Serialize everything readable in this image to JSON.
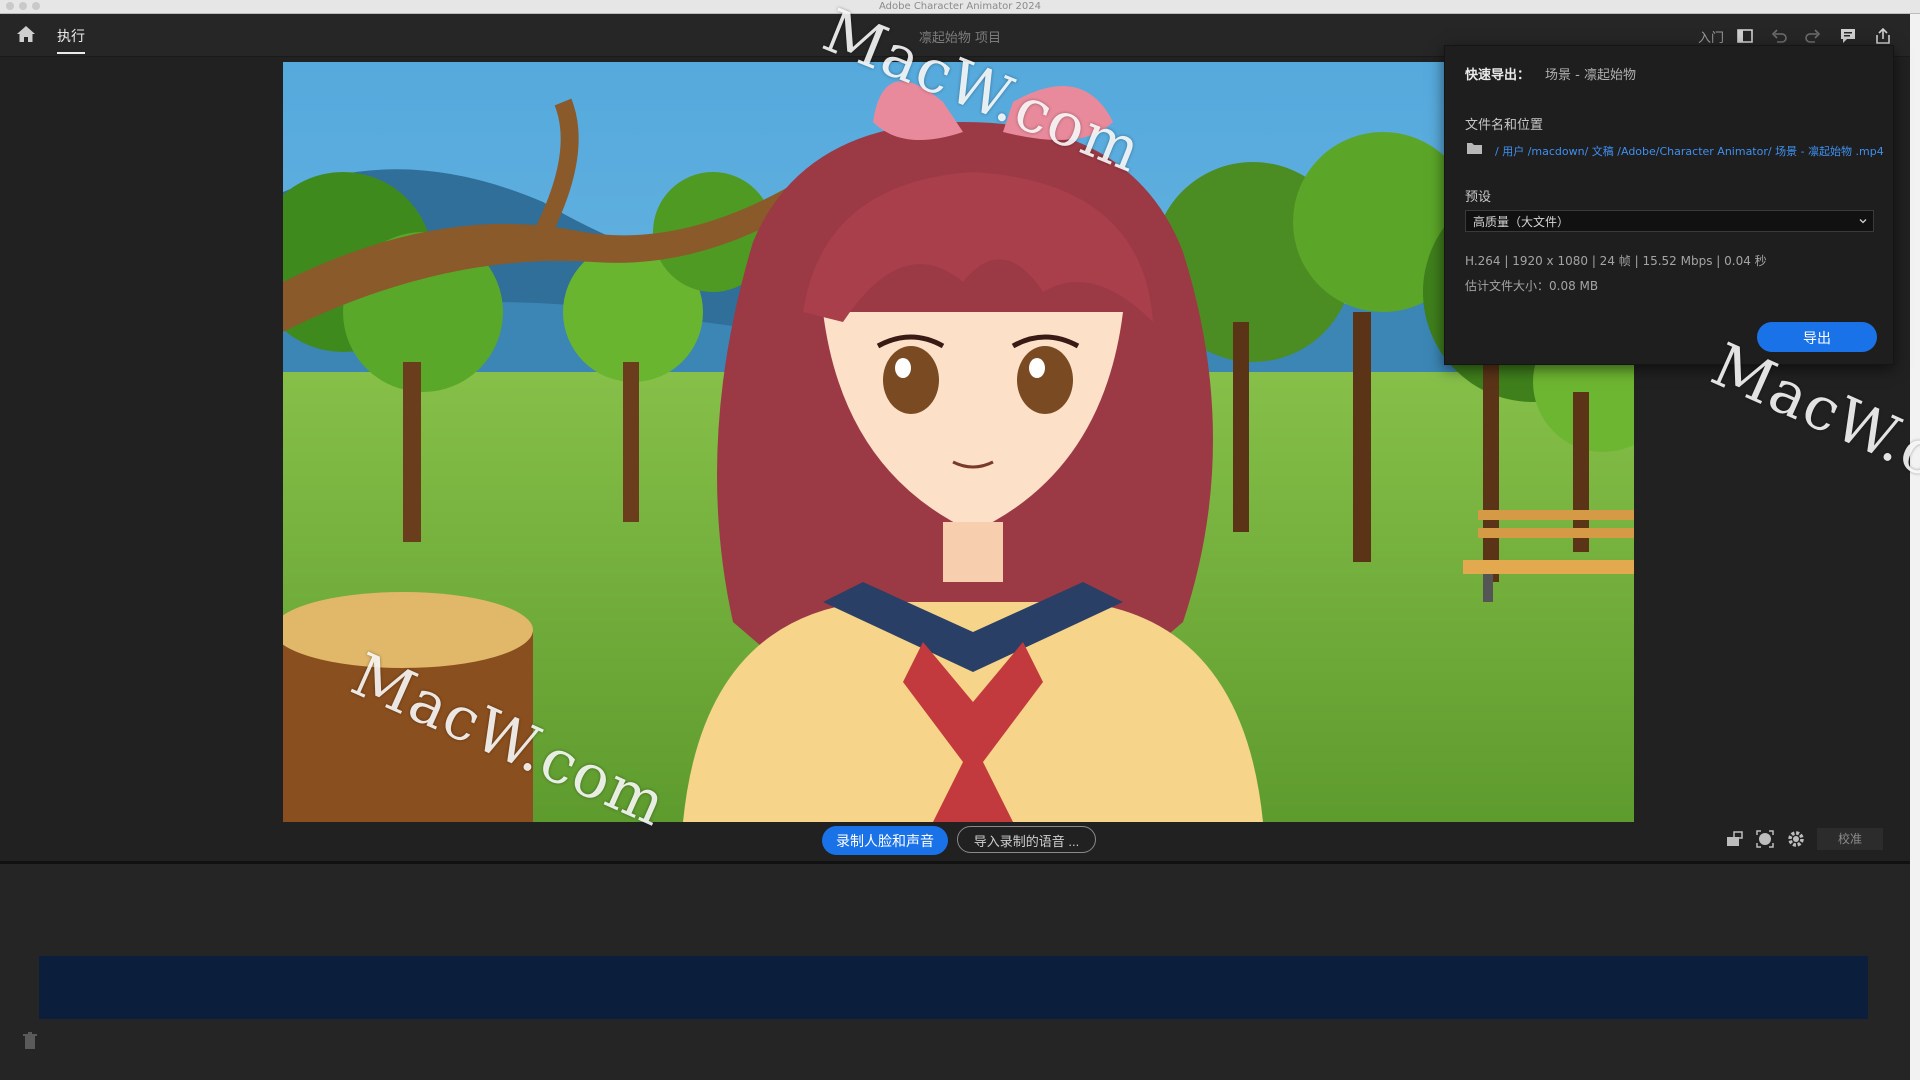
{
  "window": {
    "title": "Adobe Character Animator 2024"
  },
  "appbar": {
    "tab_perform": "执行",
    "project_title": "凛起始物 项目",
    "getting_started": "入门",
    "icons": [
      "home-icon",
      "workspace-icon",
      "undo-icon",
      "redo-icon",
      "feedback-icon",
      "share-icon"
    ]
  },
  "stage": {
    "record_label": "录制人脸和声音",
    "import_label": "导入录制的语音 ...",
    "calibrate_label": "校准"
  },
  "export_panel": {
    "heading": "快速导出：",
    "scene": "场景 - 凛起始物",
    "file_label": "文件名和位置",
    "path": "/ 用户 /macdown/ 文稿 /Adobe/Character Animator/ 场景 - 凛起始物 .mp4",
    "preset_label": "预设",
    "preset_value": "高质量（大文件）",
    "spec": "H.264 | 1920 x 1080 | 24 帧 | 15.52 Mbps | 0.04 秒",
    "size_label": "估计文件大小：",
    "size_value": "0.08 MB",
    "export_button": "导出"
  },
  "watermarks": [
    "MacW.com",
    "MacW.com",
    "MacW.c"
  ],
  "colors": {
    "accent": "#1a72e8",
    "path_link": "#3f8ff0",
    "track": "#0b1e3b",
    "panel": "#1e1e1e"
  }
}
